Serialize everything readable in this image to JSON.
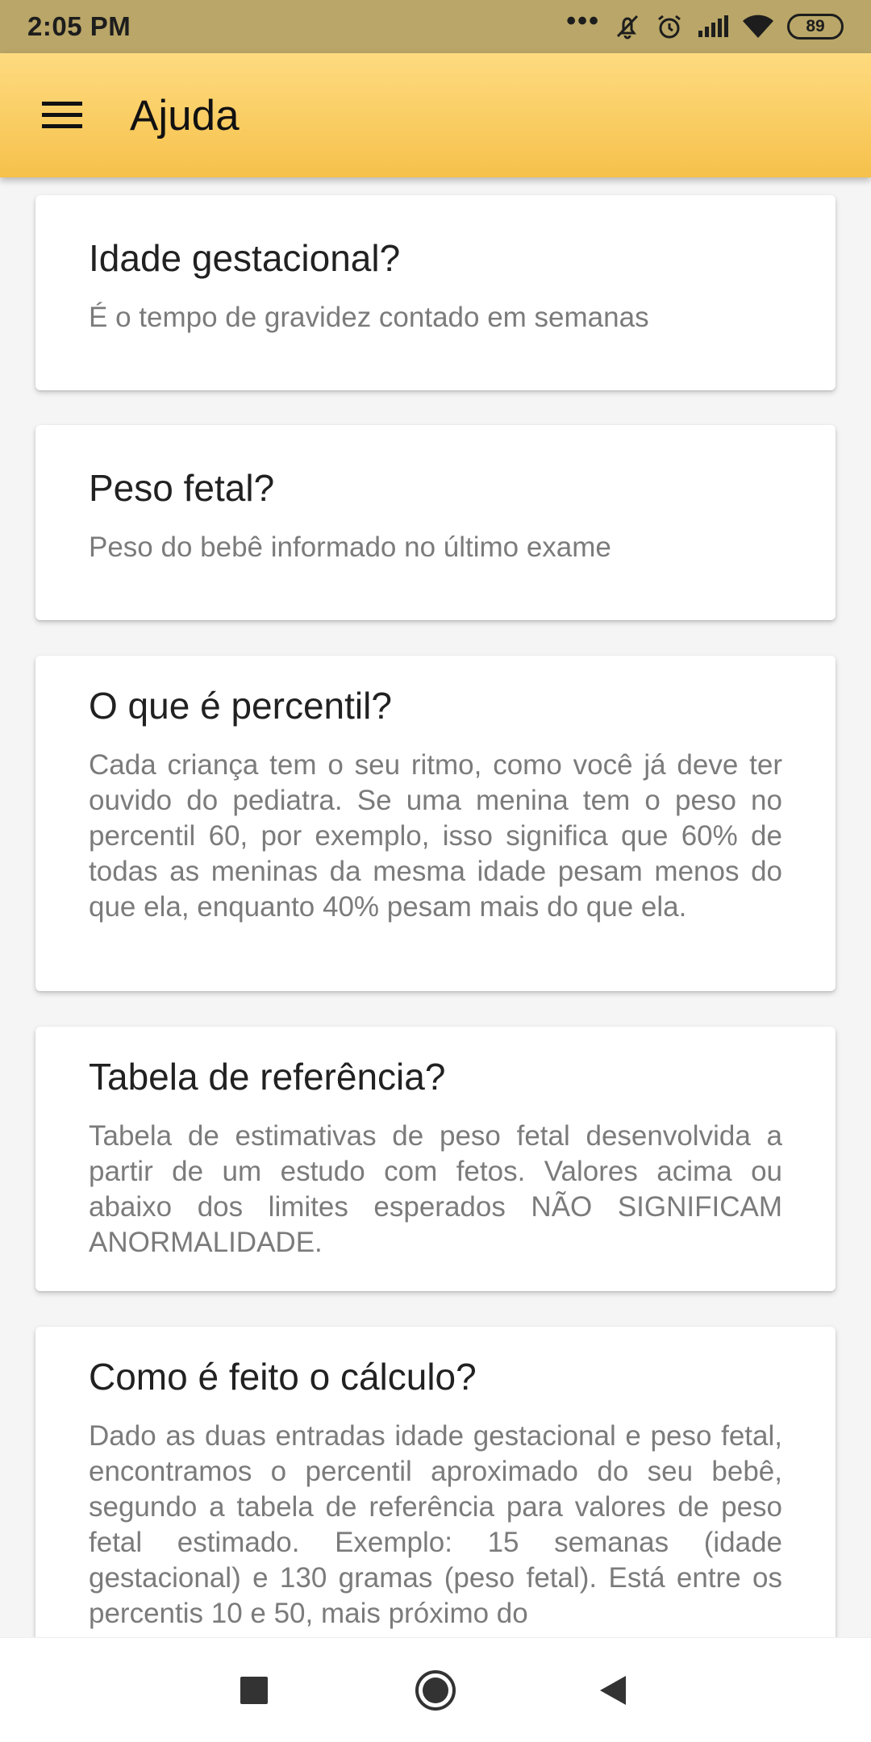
{
  "status_bar": {
    "time": "2:05 PM",
    "more_indicator": "•••",
    "battery": "89",
    "icons": [
      "more-notifications-icon",
      "alarm-off-icon",
      "alarm-clock-icon",
      "cellular-signal-icon",
      "wifi-icon",
      "battery-icon"
    ]
  },
  "app_bar": {
    "title": "Ajuda",
    "menu_icon": "hamburger-menu-icon",
    "background_colors": [
      "#fedb80",
      "#f6c14b"
    ]
  },
  "cards": [
    {
      "title": "Idade gestacional?",
      "text": "É o tempo de gravidez contado em semanas"
    },
    {
      "title": "Peso fetal?",
      "text": "Peso do bebê informado no último exame"
    },
    {
      "title": "O que é percentil?",
      "text": "Cada criança tem o seu ritmo, como você já deve ter ouvido do pediatra. Se uma menina tem o peso no percentil 60, por exemplo, isso significa que 60% de todas as meninas da mesma idade pesam menos do que ela, enquanto 40% pesam mais do que ela."
    },
    {
      "title": "Tabela de referência?",
      "text": "Tabela de estimativas de peso fetal desenvolvida a partir de um estudo com fetos. Valores acima ou abaixo dos limites esperados NÃO SIGNIFICAM ANORMALIDADE."
    },
    {
      "title": "Como é feito o cálculo?",
      "text": "Dado as duas entradas idade gestacional e peso fetal, encontramos o percentil aproximado do seu bebê, segundo a tabela de referência para valores de peso fetal estimado. Exemplo: 15 semanas (idade gestacional) e 130 gramas (peso fetal). Está entre os percentis 10 e 50, mais próximo do"
    }
  ],
  "nav_bar": {
    "buttons": [
      "recent-apps-icon",
      "home-icon",
      "back-icon"
    ]
  }
}
